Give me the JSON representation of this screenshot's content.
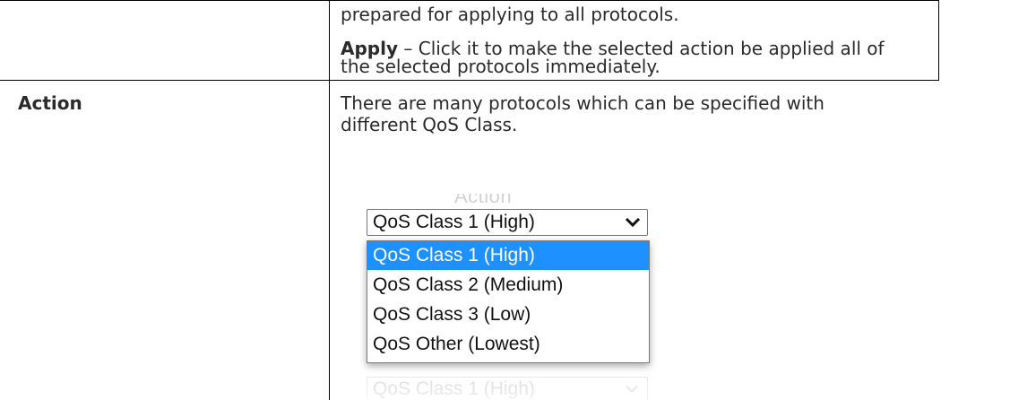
{
  "row_prev": {
    "line1": "prepared for applying to all protocols.",
    "apply_label": "Apply",
    "apply_text": " – Click it to make the selected action be applied all of",
    "apply_text2": "the selected protocols immediately."
  },
  "row_action": {
    "label": "Action",
    "desc_line1": "There are many protocols which can be specified with",
    "desc_line2": "different QoS Class."
  },
  "inset": {
    "ghost_title": "Action",
    "selected_value": "QoS Class 1 (High)",
    "options": [
      "QoS Class 1 (High)",
      "QoS Class 2 (Medium)",
      "QoS Class 3 (Low)",
      "QoS Other (Lowest)"
    ],
    "highlighted_option": "QoS Class 1 (High)",
    "ghost_bottom": "QoS Class 1 (High)",
    "highlight_color": "#1e90ff"
  }
}
